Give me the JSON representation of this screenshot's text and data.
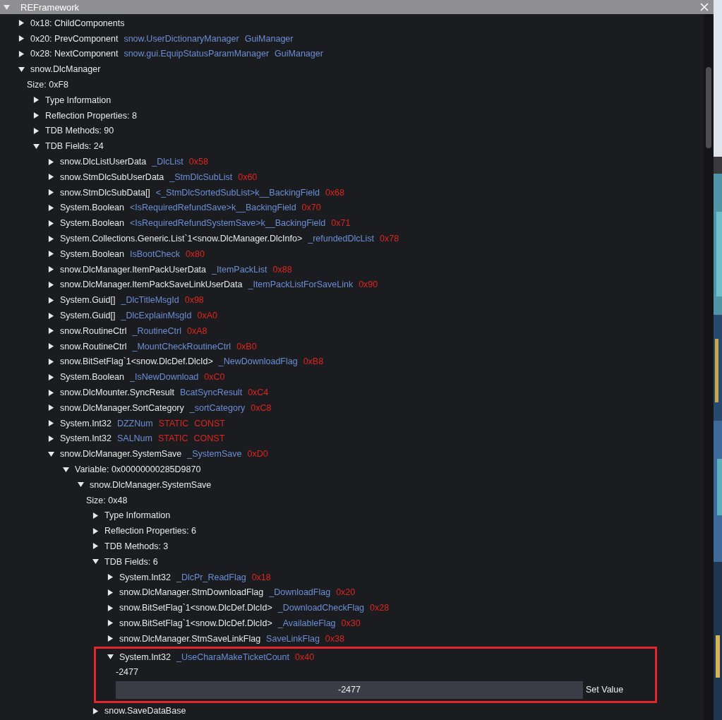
{
  "window": {
    "title": "REFramework",
    "expanded": true
  },
  "tree": [
    {
      "kind": "node",
      "label": "0x18: ChildComponents",
      "expanded": false
    },
    {
      "kind": "node",
      "label": "0x20: PrevComponent",
      "links": [
        "snow.UserDictionaryManager",
        "GuiManager"
      ],
      "expanded": false
    },
    {
      "kind": "node",
      "label": "0x28: NextComponent",
      "links": [
        "snow.gui.EquipStatusParamManager",
        "GuiManager"
      ],
      "expanded": false
    },
    {
      "kind": "node",
      "label": "snow.DlcManager",
      "expanded": true,
      "children": [
        {
          "kind": "text",
          "label": "Size: 0xF8"
        },
        {
          "kind": "node",
          "label": "Type Information",
          "expanded": false
        },
        {
          "kind": "node",
          "label": "Reflection Properties: 8",
          "expanded": false
        },
        {
          "kind": "node",
          "label": "TDB Methods: 90",
          "expanded": false
        },
        {
          "kind": "node",
          "label": "TDB Fields: 24",
          "expanded": true,
          "children": [
            {
              "kind": "node",
              "label": "snow.DlcListUserData",
              "links": [
                "_DlcList"
              ],
              "tags": [
                "0x58"
              ],
              "expanded": false
            },
            {
              "kind": "node",
              "label": "snow.StmDlcSubUserData",
              "links": [
                "_StmDlcSubList"
              ],
              "tags": [
                "0x60"
              ],
              "expanded": false
            },
            {
              "kind": "node",
              "label": "snow.StmDlcSubData[]",
              "links": [
                "<_StmDlcSortedSubList>k__BackingField"
              ],
              "tags": [
                "0x68"
              ],
              "expanded": false
            },
            {
              "kind": "node",
              "label": "System.Boolean",
              "links": [
                "<IsRequiredRefundSave>k__BackingField"
              ],
              "tags": [
                "0x70"
              ],
              "expanded": false
            },
            {
              "kind": "node",
              "label": "System.Boolean",
              "links": [
                "<IsRequiredRefundSystemSave>k__BackingField"
              ],
              "tags": [
                "0x71"
              ],
              "expanded": false
            },
            {
              "kind": "node",
              "label": "System.Collections.Generic.List`1<snow.DlcManager.DlcInfo>",
              "links": [
                "_refundedDlcList"
              ],
              "tags": [
                "0x78"
              ],
              "expanded": false
            },
            {
              "kind": "node",
              "label": "System.Boolean",
              "links": [
                "IsBootCheck"
              ],
              "tags": [
                "0x80"
              ],
              "expanded": false
            },
            {
              "kind": "node",
              "label": "snow.DlcManager.ItemPackUserData",
              "links": [
                "_ItemPackList"
              ],
              "tags": [
                "0x88"
              ],
              "expanded": false
            },
            {
              "kind": "node",
              "label": "snow.DlcManager.ItemPackSaveLinkUserData",
              "links": [
                "_ItemPackListForSaveLink"
              ],
              "tags": [
                "0x90"
              ],
              "expanded": false
            },
            {
              "kind": "node",
              "label": "System.Guid[]",
              "links": [
                "_DlcTitleMsgId"
              ],
              "tags": [
                "0x98"
              ],
              "expanded": false
            },
            {
              "kind": "node",
              "label": "System.Guid[]",
              "links": [
                "_DlcExplainMsgId"
              ],
              "tags": [
                "0xA0"
              ],
              "expanded": false
            },
            {
              "kind": "node",
              "label": "snow.RoutineCtrl",
              "links": [
                "_RoutineCtrl"
              ],
              "tags": [
                "0xA8"
              ],
              "expanded": false
            },
            {
              "kind": "node",
              "label": "snow.RoutineCtrl",
              "links": [
                "_MountCheckRoutineCtrl"
              ],
              "tags": [
                "0xB0"
              ],
              "expanded": false
            },
            {
              "kind": "node",
              "label": "snow.BitSetFlag`1<snow.DlcDef.DlcId>",
              "links": [
                "_NewDownloadFlag"
              ],
              "tags": [
                "0xB8"
              ],
              "expanded": false
            },
            {
              "kind": "node",
              "label": "System.Boolean",
              "links": [
                "_IsNewDownload"
              ],
              "tags": [
                "0xC0"
              ],
              "expanded": false
            },
            {
              "kind": "node",
              "label": "snow.DlcMounter.SyncResult",
              "links": [
                "BcatSyncResult"
              ],
              "tags": [
                "0xC4"
              ],
              "expanded": false
            },
            {
              "kind": "node",
              "label": "snow.DlcManager.SortCategory",
              "links": [
                "_sortCategory"
              ],
              "tags": [
                "0xC8"
              ],
              "expanded": false
            },
            {
              "kind": "node",
              "label": "System.Int32",
              "links": [
                "DZZNum"
              ],
              "tags": [
                "STATIC",
                "CONST"
              ],
              "expanded": false
            },
            {
              "kind": "node",
              "label": "System.Int32",
              "links": [
                "SALNum"
              ],
              "tags": [
                "STATIC",
                "CONST"
              ],
              "expanded": false
            },
            {
              "kind": "node",
              "label": "snow.DlcManager.SystemSave",
              "links": [
                "_SystemSave"
              ],
              "tags": [
                "0xD0"
              ],
              "expanded": true,
              "children": [
                {
                  "kind": "node",
                  "label": "Variable: 0x00000000285D9870",
                  "expanded": true,
                  "children": [
                    {
                      "kind": "node",
                      "label": "snow.DlcManager.SystemSave",
                      "expanded": true,
                      "children": [
                        {
                          "kind": "text",
                          "label": "Size: 0x48"
                        },
                        {
                          "kind": "node",
                          "label": "Type Information",
                          "expanded": false
                        },
                        {
                          "kind": "node",
                          "label": "Reflection Properties: 6",
                          "expanded": false
                        },
                        {
                          "kind": "node",
                          "label": "TDB Methods: 3",
                          "expanded": false
                        },
                        {
                          "kind": "node",
                          "label": "TDB Fields: 6",
                          "expanded": true,
                          "children": [
                            {
                              "kind": "node",
                              "label": "System.Int32",
                              "links": [
                                "_DlcPr_ReadFlag"
                              ],
                              "tags": [
                                "0x18"
                              ],
                              "expanded": false
                            },
                            {
                              "kind": "node",
                              "label": "snow.DlcManager.StmDownloadFlag",
                              "links": [
                                "_DownloadFlag"
                              ],
                              "tags": [
                                "0x20"
                              ],
                              "expanded": false
                            },
                            {
                              "kind": "node",
                              "label": "snow.BitSetFlag`1<snow.DlcDef.DlcId>",
                              "links": [
                                "_DownloadCheckFlag"
                              ],
                              "tags": [
                                "0x28"
                              ],
                              "expanded": false
                            },
                            {
                              "kind": "node",
                              "label": "snow.BitSetFlag`1<snow.DlcDef.DlcId>",
                              "links": [
                                "_AvailableFlag"
                              ],
                              "tags": [
                                "0x30"
                              ],
                              "expanded": false
                            },
                            {
                              "kind": "node",
                              "label": "snow.DlcManager.StmSaveLinkFlag",
                              "links": [
                                "SaveLinkFlag"
                              ],
                              "tags": [
                                "0x38"
                              ],
                              "expanded": false
                            },
                            {
                              "kind": "node",
                              "label": "System.Int32",
                              "links": [
                                "_UseCharaMakeTicketCount"
                              ],
                              "tags": [
                                "0x40"
                              ],
                              "expanded": true,
                              "highlighted": true,
                              "children": [
                                {
                                  "kind": "text",
                                  "label": "-2477"
                                },
                                {
                                  "kind": "editor",
                                  "value": "-2477",
                                  "button": "Set Value"
                                }
                              ]
                            }
                          ]
                        },
                        {
                          "kind": "node",
                          "label": "snow.SaveDataBase",
                          "expanded": false
                        }
                      ]
                    }
                  ]
                }
              ]
            }
          ]
        }
      ]
    }
  ]
}
